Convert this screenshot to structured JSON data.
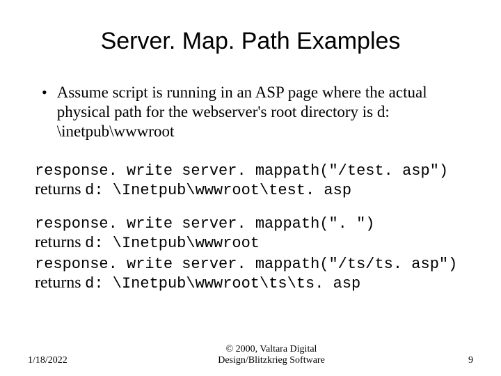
{
  "title": "Server. Map. Path Examples",
  "bullet": "Assume script is running in an ASP page where the actual physical path for the webserver's root directory is d: \\inetpub\\wwwroot",
  "examples": [
    {
      "code": "response. write server. mappath(\"/test. asp\")",
      "ret_label": "returns",
      "ret_path": "d: \\Inetpub\\wwwroot\\test. asp"
    },
    {
      "code": "response. write server. mappath(\". \")",
      "ret_label": "returns",
      "ret_path": "d: \\Inetpub\\wwwroot"
    },
    {
      "code": "response. write server. mappath(\"/ts/ts. asp\")",
      "ret_label": "returns",
      "ret_path": "d: \\Inetpub\\wwwroot\\ts\\ts. asp"
    }
  ],
  "footer": {
    "date": "1/18/2022",
    "copyright_line1": "© 2000, Valtara Digital",
    "copyright_line2": "Design/Blitzkrieg Software",
    "pagenum": "9"
  }
}
